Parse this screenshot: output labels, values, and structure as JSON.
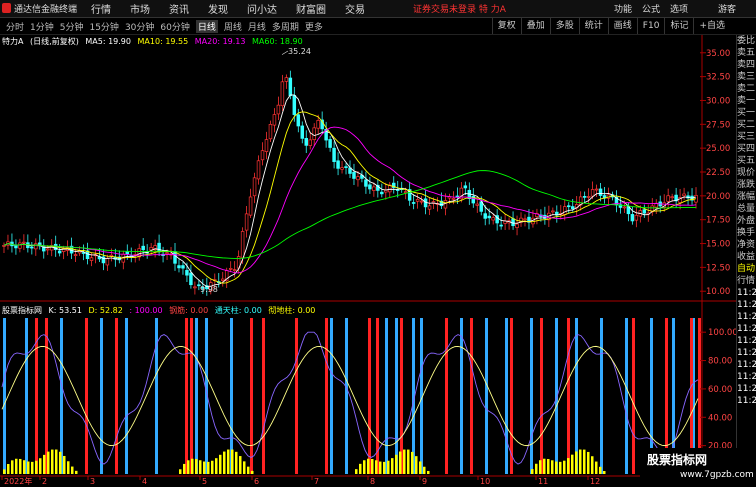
{
  "menubar": {
    "app_title": "通达信金融终端",
    "items": [
      "行情",
      "市场",
      "资讯",
      "发现",
      "问小达",
      "财富圈",
      "交易"
    ],
    "alert": "证券交易未登录  特 力A",
    "right": [
      "功能",
      "公式",
      "选项"
    ],
    "guest": "游客"
  },
  "toolbar": {
    "periods": [
      "分时",
      "1分钟",
      "5分钟",
      "15分钟",
      "30分钟",
      "60分钟",
      "日线",
      "周线",
      "月线",
      "多周期",
      "更多"
    ],
    "active": "日线",
    "buttons": [
      "复权",
      "叠加",
      "多股",
      "统计",
      "画线",
      "F10",
      "标记",
      "+自选"
    ]
  },
  "stock": {
    "name": "特力A",
    "mode": "(日线,前复权)",
    "ma5": "MA5: 19.90",
    "ma10": "MA10: 19.55",
    "ma20": "MA20: 19.13",
    "ma60": "MA60: 18.90",
    "high_label": "35.24",
    "low_label": "9.98"
  },
  "indicator": {
    "name": "股票指标网",
    "k": "K: 53.51",
    "d": "D: 52.82",
    "v100": ": 100.00",
    "v1": "钢筋: 0.00",
    "v2": "通天柱: 0.00",
    "v3": "彻地柱: 0.00"
  },
  "price_axis": [
    "35.00",
    "32.50",
    "30.00",
    "27.50",
    "25.00",
    "22.50",
    "20.00",
    "17.50",
    "15.00",
    "12.50",
    "10.00"
  ],
  "ind_axis": [
    "100.00",
    "80.00",
    "60.00",
    "40.00",
    "20.00"
  ],
  "time_axis": [
    "2022年",
    "2",
    "3",
    "4",
    "5",
    "6",
    "7",
    "8",
    "9",
    "10",
    "11",
    "12"
  ],
  "side_panel": [
    "委比",
    "卖五",
    "卖四",
    "卖三",
    "卖二",
    "卖一",
    "买一",
    "买二",
    "买三",
    "买四",
    "买五",
    "现价",
    "涨跌",
    "涨幅",
    "总量",
    "外盘",
    "换手",
    "净资",
    "收益",
    "自动",
    "行情",
    "11:26",
    "11:26",
    "11:26",
    "11:26",
    "11:27",
    "11:27",
    "11:27",
    "11:27",
    "11:28",
    "11:29"
  ],
  "watermark": {
    "title": "股票指标网",
    "url": "www.7gpzb.com"
  },
  "colors": {
    "up": "#ff3333",
    "down": "#33ffff",
    "ma5": "#ffffff",
    "ma10": "#ffff00",
    "ma20": "#ff00ff",
    "ma60": "#00ff00",
    "k": "#ffffff",
    "d": "#ffff00",
    "blue_bar": "#33aaff",
    "red_bar": "#ff2222",
    "yellow_bar": "#ffff00"
  }
}
